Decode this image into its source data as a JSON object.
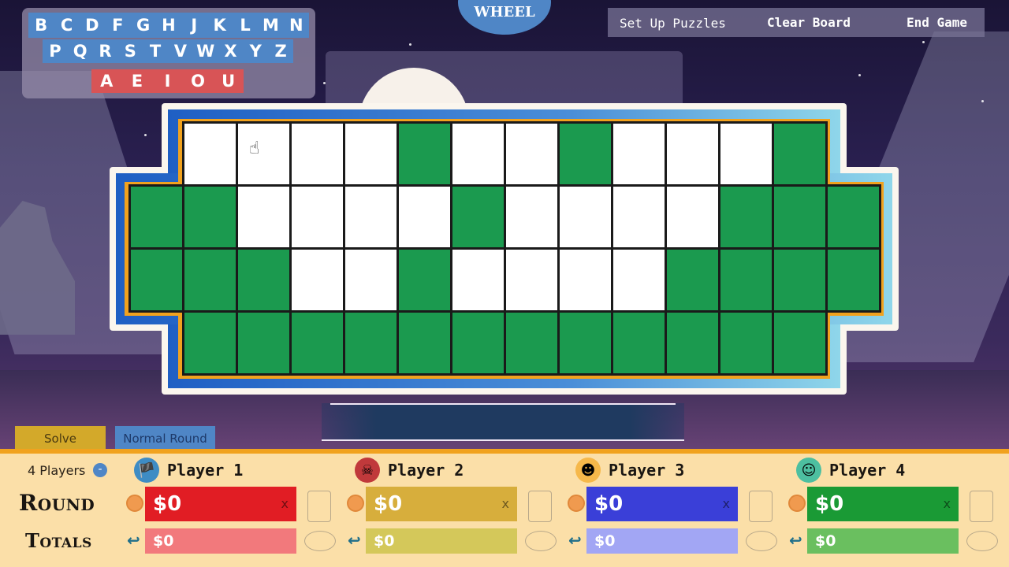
{
  "letters": {
    "consonants_row1": [
      "B",
      "C",
      "D",
      "F",
      "G",
      "H",
      "J",
      "K",
      "L",
      "M",
      "N"
    ],
    "consonants_row2": [
      "P",
      "Q",
      "R",
      "S",
      "T",
      "V",
      "W",
      "X",
      "Y",
      "Z"
    ],
    "vowels": [
      "A",
      "E",
      "I",
      "O",
      "U"
    ],
    "consonant_color": "#4f86c6",
    "vowel_color": "#d85456"
  },
  "wheel_button": {
    "label": "WHEEL"
  },
  "menu": {
    "setup_label": "Set Up Puzzles",
    "clear_label": "Clear Board",
    "end_label": "End Game"
  },
  "board": {
    "rows": [
      [
        "W",
        "W",
        "W",
        "W",
        "G",
        "W",
        "W",
        "G",
        "W",
        "W",
        "W",
        "G"
      ],
      [
        "G",
        "G",
        "W",
        "W",
        "W",
        "W",
        "G",
        "W",
        "W",
        "W",
        "W",
        "G",
        "G",
        "G"
      ],
      [
        "G",
        "G",
        "G",
        "W",
        "W",
        "G",
        "W",
        "W",
        "W",
        "W",
        "G",
        "G",
        "G",
        "G"
      ],
      [
        "G",
        "G",
        "G",
        "G",
        "G",
        "G",
        "G",
        "G",
        "G",
        "G",
        "G",
        "G"
      ]
    ],
    "tile_color_blank": "#ffffff",
    "tile_color_unused": "#1b9a4f"
  },
  "controls": {
    "solve_label": "Solve",
    "round_type_label": "Normal Round",
    "players_count_label": "4 Players",
    "minus_label": "-"
  },
  "labels": {
    "round": "Round",
    "totals": "Totals"
  },
  "players": [
    {
      "name": "Player 1",
      "round_score": "$0",
      "total_score": "$0",
      "round_color": "#e11d24",
      "total_color": "#f2797c",
      "avatar": "pirate-icon",
      "avatar_bg": "#3e8cc4"
    },
    {
      "name": "Player 2",
      "round_score": "$0",
      "total_score": "$0",
      "round_color": "#d7ae3c",
      "total_color": "#d4c85a",
      "avatar": "pirate-girl-icon",
      "avatar_bg": "#c0393b"
    },
    {
      "name": "Player 3",
      "round_score": "$0",
      "total_score": "$0",
      "round_color": "#3a3fd8",
      "total_color": "#a2a6f4",
      "avatar": "blindfold-icon",
      "avatar_bg": "#f6b84a"
    },
    {
      "name": "Player 4",
      "round_score": "$0",
      "total_score": "$0",
      "round_color": "#1a9a35",
      "total_color": "#6abf5f",
      "avatar": "red-bandana-icon",
      "avatar_bg": "#4dbfa0"
    }
  ],
  "remove_label": "x"
}
